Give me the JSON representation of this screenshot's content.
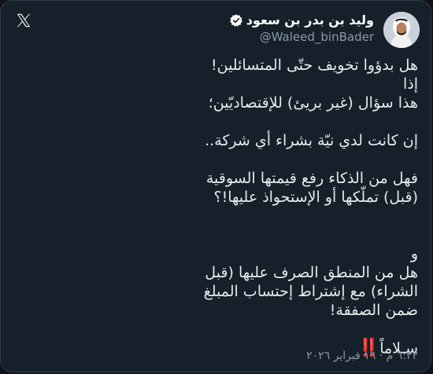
{
  "author": {
    "display_name": "وليد بن بدر بن سعود",
    "handle": "@Waleed_binBader",
    "verified": true
  },
  "icons": {
    "avatar": "profile-photo",
    "verified": "verified-badge-icon",
    "logo": "x-logo-icon"
  },
  "tweet": {
    "lines": [
      "هل بدؤوا تخويف حتّى المتسائلين!",
      "إذا",
      "هذا سؤال (غير بريئ) للإقتصاديّين؛",
      "إن كانت لدي نيّة بشراء أي شركة..",
      "فهل من الذكاء رفع قيمتها السوقية",
      "(قبل) تملّكها أو الإستحواذ عليها!؟",
      "و",
      "هل من المنطق الصرف عليها (قبل",
      "الشراء) مع إشتراط إحتساب المبلغ",
      "ضمن الصفقة!",
      "سـلاماً",
      "‼️"
    ]
  },
  "timestamp": "٦:٣٢ م · ١٦ فبراير ٢٠٢٦",
  "colors": {
    "background": "#15202b",
    "text": "#e7e9ea",
    "secondary": "#8b98a5",
    "verified": "#ffffff",
    "accent_red": "#f4212e"
  }
}
